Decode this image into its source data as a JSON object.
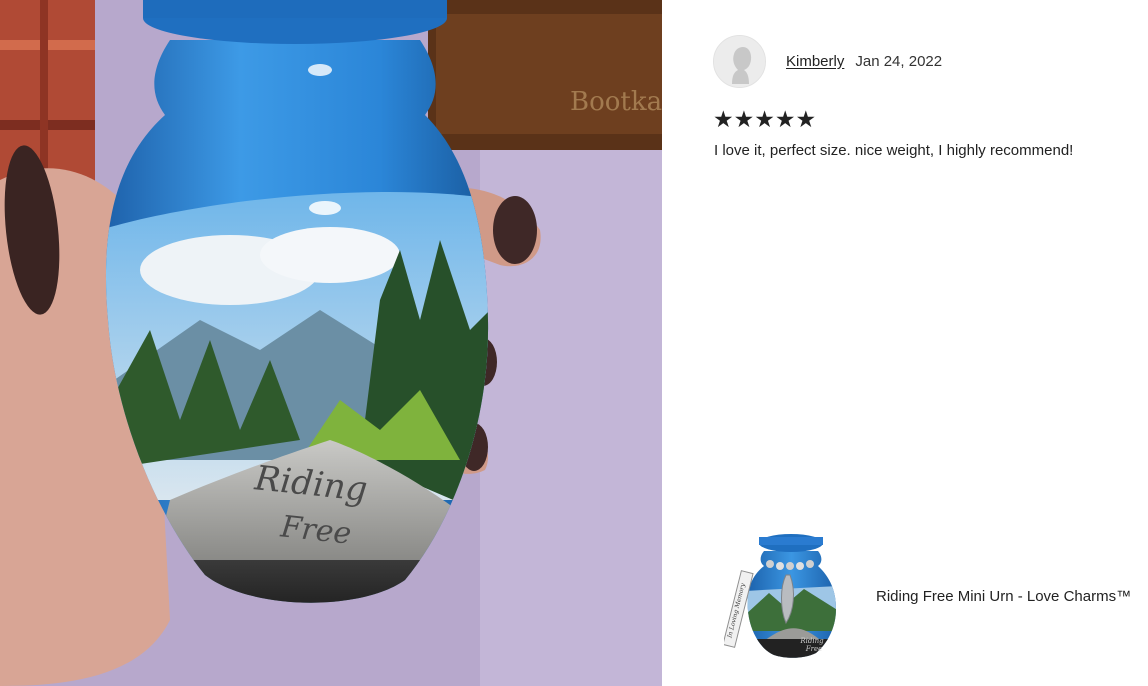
{
  "review": {
    "reviewer_name": "Kimberly",
    "date": "Jan 24, 2022",
    "rating": 5,
    "stars": "★★★★★",
    "text": "I love it, perfect size. nice weight, I highly recommend!"
  },
  "product": {
    "title": "Riding Free Mini Urn - Love Charms™"
  },
  "photo": {
    "urn_text_line1": "Riding",
    "urn_text_line2": "Free"
  },
  "thumbnail": {
    "ribbon_text": "In Loving Memory",
    "urn_text_line1": "Riding",
    "urn_text_line2": "Free"
  },
  "colors": {
    "urn_blue": "#2f86d6",
    "wall": "#b7a8cc"
  }
}
